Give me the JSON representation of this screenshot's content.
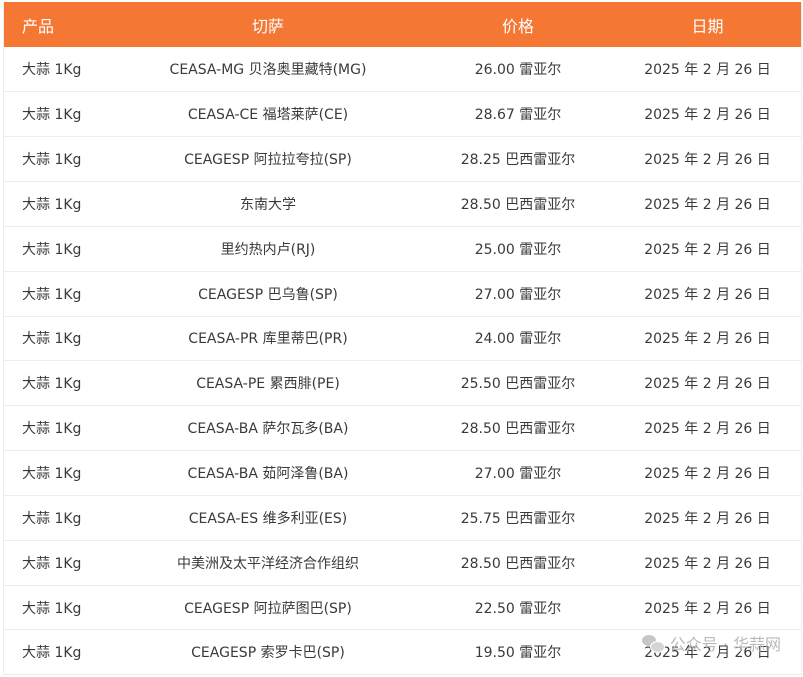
{
  "table": {
    "headers": {
      "product": "产品",
      "market": "切萨",
      "price": "价格",
      "date": "日期"
    },
    "rows": [
      {
        "product": "大蒜 1Kg",
        "market": "CEASA-MG 贝洛奥里藏特(MG)",
        "price": "26.00 雷亚尔",
        "date": "2025 年 2 月 26 日"
      },
      {
        "product": "大蒜 1Kg",
        "market": "CEASA-CE 福塔莱萨(CE)",
        "price": "28.67 雷亚尔",
        "date": "2025 年 2 月 26 日"
      },
      {
        "product": "大蒜 1Kg",
        "market": "CEAGESP 阿拉拉夸拉(SP)",
        "price": "28.25 巴西雷亚尔",
        "date": "2025 年 2 月 26 日"
      },
      {
        "product": "大蒜 1Kg",
        "market": "东南大学",
        "price": "28.50 巴西雷亚尔",
        "date": "2025 年 2 月 26 日"
      },
      {
        "product": "大蒜 1Kg",
        "market": "里约热内卢(RJ)",
        "price": "25.00 雷亚尔",
        "date": "2025 年 2 月 26 日"
      },
      {
        "product": "大蒜 1Kg",
        "market": "CEAGESP 巴乌鲁(SP)",
        "price": "27.00 雷亚尔",
        "date": "2025 年 2 月 26 日"
      },
      {
        "product": "大蒜 1Kg",
        "market": "CEASA-PR 库里蒂巴(PR)",
        "price": "24.00 雷亚尔",
        "date": "2025 年 2 月 26 日"
      },
      {
        "product": "大蒜 1Kg",
        "market": "CEASA-PE 累西腓(PE)",
        "price": "25.50 巴西雷亚尔",
        "date": "2025 年 2 月 26 日"
      },
      {
        "product": "大蒜 1Kg",
        "market": "CEASA-BA 萨尔瓦多(BA)",
        "price": "28.50 巴西雷亚尔",
        "date": "2025 年 2 月 26 日"
      },
      {
        "product": "大蒜 1Kg",
        "market": "CEASA-BA 茹阿泽鲁(BA)",
        "price": "27.00 雷亚尔",
        "date": "2025 年 2 月 26 日"
      },
      {
        "product": "大蒜 1Kg",
        "market": "CEASA-ES 维多利亚(ES)",
        "price": "25.75 巴西雷亚尔",
        "date": "2025 年 2 月 26 日"
      },
      {
        "product": "大蒜 1Kg",
        "market": "中美洲及太平洋经济合作组织",
        "price": "28.50 巴西雷亚尔",
        "date": "2025 年 2 月 26 日"
      },
      {
        "product": "大蒜 1Kg",
        "market": "CEAGESP 阿拉萨图巴(SP)",
        "price": "22.50 雷亚尔",
        "date": "2025 年 2 月 26 日"
      },
      {
        "product": "大蒜 1Kg",
        "market": "CEAGESP 索罗卡巴(SP)",
        "price": "19.50 雷亚尔",
        "date": "2025 年 2 月 26 日"
      }
    ]
  },
  "watermark": {
    "text": "公众号 · 华蒜网",
    "icon": "wechat-icon"
  },
  "colors": {
    "header_bg": "#f47734",
    "header_text": "#ffffff",
    "row_border": "#ececec",
    "body_text": "#3a3a3a"
  }
}
